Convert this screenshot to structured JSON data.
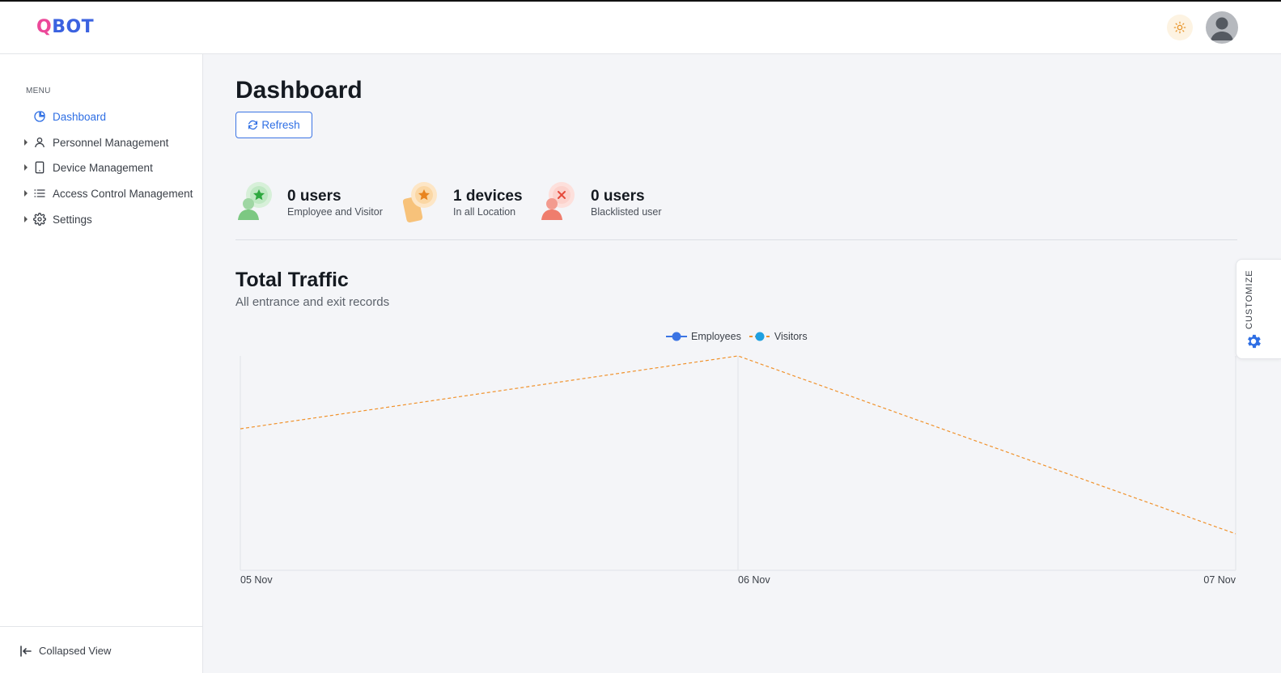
{
  "header": {
    "logo_q": "Q",
    "logo_rest": "BOT",
    "theme_icon": "sun-icon",
    "avatar_icon": "user-avatar-icon"
  },
  "sidebar": {
    "caption": "MENU",
    "items": [
      {
        "label": "Dashboard",
        "icon": "pie-chart-icon",
        "active": true
      },
      {
        "label": "Personnel Management",
        "icon": "user-icon"
      },
      {
        "label": "Device Management",
        "icon": "tablet-icon"
      },
      {
        "label": "Access Control Management",
        "icon": "list-icon"
      },
      {
        "label": "Settings",
        "icon": "gear-icon"
      }
    ],
    "footer_label": "Collapsed View"
  },
  "main": {
    "title": "Dashboard",
    "refresh_label": "Refresh",
    "stats": [
      {
        "value": "0 users",
        "caption": "Employee and Visitor",
        "color": "#3bb54a"
      },
      {
        "value": "1 devices",
        "caption": "In all Location",
        "color": "#f0a22c"
      },
      {
        "value": "0 users",
        "caption": "Blacklisted user",
        "color": "#ef6a57"
      }
    ],
    "traffic_title": "Total Traffic",
    "traffic_subtitle": "All entrance and exit records",
    "customize_label": "CUSTOMIZE"
  },
  "colors": {
    "accent": "#2f6fe4",
    "employees": "#3b74e4",
    "visitors": "#f0922c"
  },
  "chart_data": {
    "type": "line",
    "categories": [
      "05 Nov",
      "06 Nov",
      "07 Nov"
    ],
    "series": [
      {
        "name": "Employees",
        "values": [
          0,
          0,
          0
        ]
      },
      {
        "name": "Visitors",
        "values": [
          0.66,
          1,
          0.17
        ]
      }
    ],
    "grid": "vertical",
    "legend": "top-center"
  }
}
